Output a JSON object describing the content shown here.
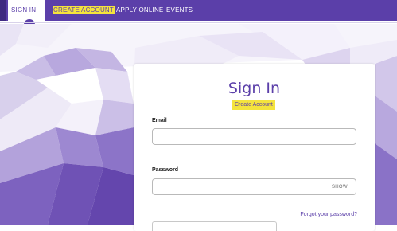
{
  "nav": {
    "items": [
      {
        "label": "SIGN IN"
      },
      {
        "label": "CREATE ACCOUNT"
      },
      {
        "label": "APPLY ONLINE"
      },
      {
        "label": "EVENTS"
      }
    ]
  },
  "signin_card": {
    "title": "Sign In",
    "create_account_link": "Create Account",
    "email_label": "Email",
    "email_value": "",
    "password_label": "Password",
    "password_value": "",
    "show_toggle": "SHOW",
    "forgot_link": "Forgot your password?"
  },
  "colors": {
    "brand_purple": "#5b3fa9",
    "highlight_yellow": "#f4e33d"
  }
}
